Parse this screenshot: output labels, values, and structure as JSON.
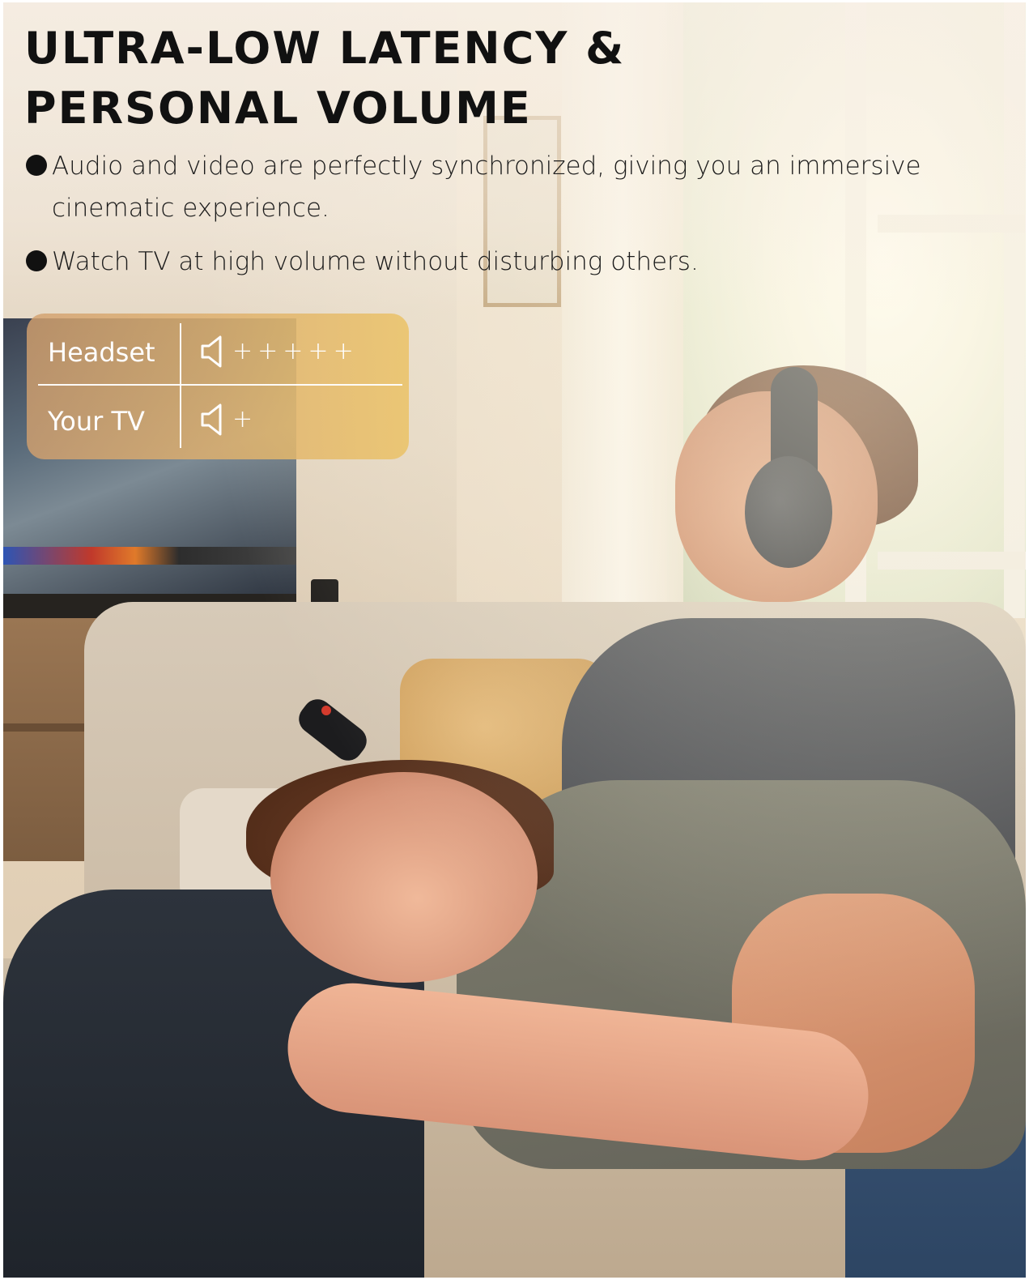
{
  "headline": {
    "line1": "ULTRA-LOW LATENCY &",
    "line2": "PERSONAL VOLUME"
  },
  "bullets": [
    {
      "text": "Audio and video are perfectly synchronized, giving you an immersive cinematic experience."
    },
    {
      "text": "Watch TV at high volume without disturbing others."
    }
  ],
  "volume_comparison": {
    "rows": [
      {
        "label": "Headset",
        "icon": "speaker-icon",
        "plus_count": 5,
        "plus_glyph": "+"
      },
      {
        "label": "Your TV",
        "icon": "speaker-icon",
        "plus_count": 1,
        "plus_glyph": "+"
      }
    ],
    "colors": {
      "card_start": "#d2a06e",
      "card_end": "#ebc369",
      "text": "#ffffff"
    }
  },
  "photo": {
    "icons": [
      "over-ear-headphones",
      "tv-remote",
      "television",
      "sofa"
    ]
  }
}
